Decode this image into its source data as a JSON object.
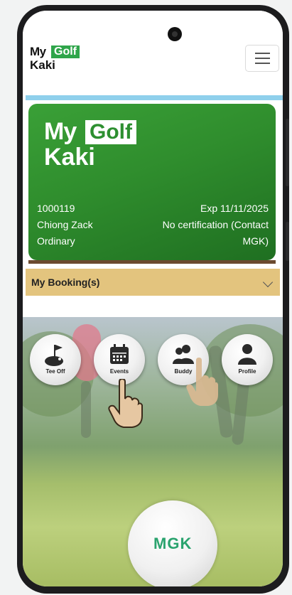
{
  "header": {
    "logo_line1": "My",
    "logo_badge": "Golf",
    "logo_line2": "Kaki"
  },
  "card": {
    "logo_line1": "My",
    "logo_badge": "Golf",
    "logo_line2": "Kaki",
    "member_id": "1000119",
    "expiry": "Exp 11/11/2025",
    "member_name": "Chiong Zack",
    "certification": "No certification (Contact",
    "membership_type": "Ordinary",
    "certification_contact": "MGK)"
  },
  "booking": {
    "label": "My Booking(s)"
  },
  "actions": [
    {
      "label": "Tee Off",
      "icon": "golf-flag-icon"
    },
    {
      "label": "Events",
      "icon": "calendar-icon"
    },
    {
      "label": "Buddy",
      "icon": "buddy-icon"
    },
    {
      "label": "Profile",
      "icon": "person-icon"
    }
  ],
  "ball": {
    "brand_text": "MGK"
  },
  "colors": {
    "brand_green": "#2fa54a",
    "booking_bar": "#e3c47e",
    "accent_blue": "#8fd0ec"
  }
}
